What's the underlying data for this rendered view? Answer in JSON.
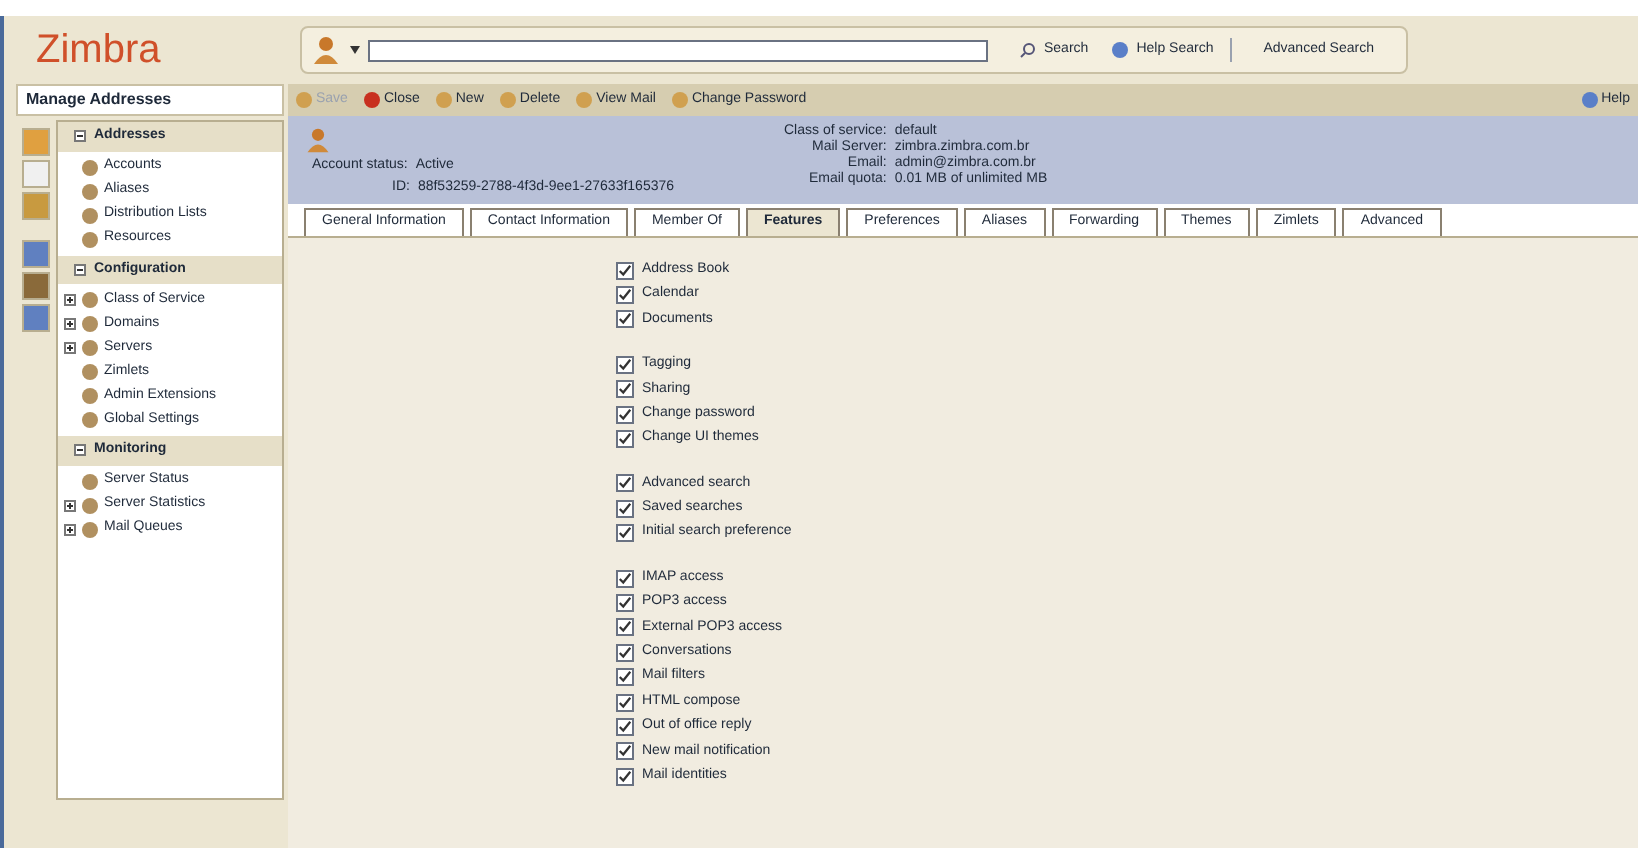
{
  "logo": "Zimbra",
  "search": {
    "buttons": [
      "Search",
      "Help Search"
    ],
    "advanced": "Advanced Search"
  },
  "sidebar": {
    "title": "Manage Addresses",
    "sections": [
      {
        "title": "Addresses",
        "items": [
          {
            "label": "Accounts",
            "expandable": false
          },
          {
            "label": "Aliases",
            "expandable": false
          },
          {
            "label": "Distribution Lists",
            "expandable": false
          },
          {
            "label": "Resources",
            "expandable": false
          }
        ]
      },
      {
        "title": "Configuration",
        "items": [
          {
            "label": "Class of Service",
            "expandable": true
          },
          {
            "label": "Domains",
            "expandable": true
          },
          {
            "label": "Servers",
            "expandable": true
          },
          {
            "label": "Zimlets",
            "expandable": false
          },
          {
            "label": "Admin Extensions",
            "expandable": false
          },
          {
            "label": "Global Settings",
            "expandable": false
          }
        ]
      },
      {
        "title": "Monitoring",
        "items": [
          {
            "label": "Server Status",
            "expandable": false
          },
          {
            "label": "Server Statistics",
            "expandable": true
          },
          {
            "label": "Mail Queues",
            "expandable": true
          }
        ]
      }
    ]
  },
  "toolbar": [
    "Save",
    "Close",
    "New",
    "Delete",
    "View Mail",
    "Change Password"
  ],
  "help": "Help",
  "account": {
    "status_label": "Account status:",
    "status": "Active",
    "id_label": "ID:",
    "id": "88f53259-2788-4f3d-9ee1-27633f165376",
    "details": [
      {
        "label": "Class of service:",
        "value": "default"
      },
      {
        "label": "Mail Server:",
        "value": "zimbra.zimbra.com.br"
      },
      {
        "label": "Email:",
        "value": "admin@zimbra.com.br"
      },
      {
        "label": "Email quota:",
        "value": "0.01 MB of unlimited MB"
      }
    ]
  },
  "tabs": [
    {
      "label": "General Information",
      "selected": false
    },
    {
      "label": "Contact Information",
      "selected": false
    },
    {
      "label": "Member Of",
      "selected": false
    },
    {
      "label": "Features",
      "selected": true
    },
    {
      "label": "Preferences",
      "selected": false
    },
    {
      "label": "Aliases",
      "selected": false
    },
    {
      "label": "Forwarding",
      "selected": false
    },
    {
      "label": "Themes",
      "selected": false
    },
    {
      "label": "Zimlets",
      "selected": false
    },
    {
      "label": "Advanced",
      "selected": false
    }
  ],
  "feature_groups": [
    [
      {
        "label": "Address Book",
        "checked": true
      },
      {
        "label": "Calendar",
        "checked": true
      },
      {
        "label": "Documents",
        "checked": true
      }
    ],
    [
      {
        "label": "Tagging",
        "checked": true
      },
      {
        "label": "Sharing",
        "checked": true
      },
      {
        "label": "Change password",
        "checked": true
      },
      {
        "label": "Change UI themes",
        "checked": true
      }
    ],
    [
      {
        "label": "Advanced search",
        "checked": true
      },
      {
        "label": "Saved searches",
        "checked": true
      },
      {
        "label": "Initial search preference",
        "checked": true
      }
    ],
    [
      {
        "label": "IMAP access",
        "checked": true
      },
      {
        "label": "POP3 access",
        "checked": true
      },
      {
        "label": "External POP3 access",
        "checked": true
      },
      {
        "label": "Conversations",
        "checked": true
      },
      {
        "label": "Mail filters",
        "checked": true
      },
      {
        "label": "HTML compose",
        "checked": true
      },
      {
        "label": "Out of office reply",
        "checked": true
      },
      {
        "label": "New mail notification",
        "checked": true
      },
      {
        "label": "Mail identities",
        "checked": true
      }
    ]
  ]
}
